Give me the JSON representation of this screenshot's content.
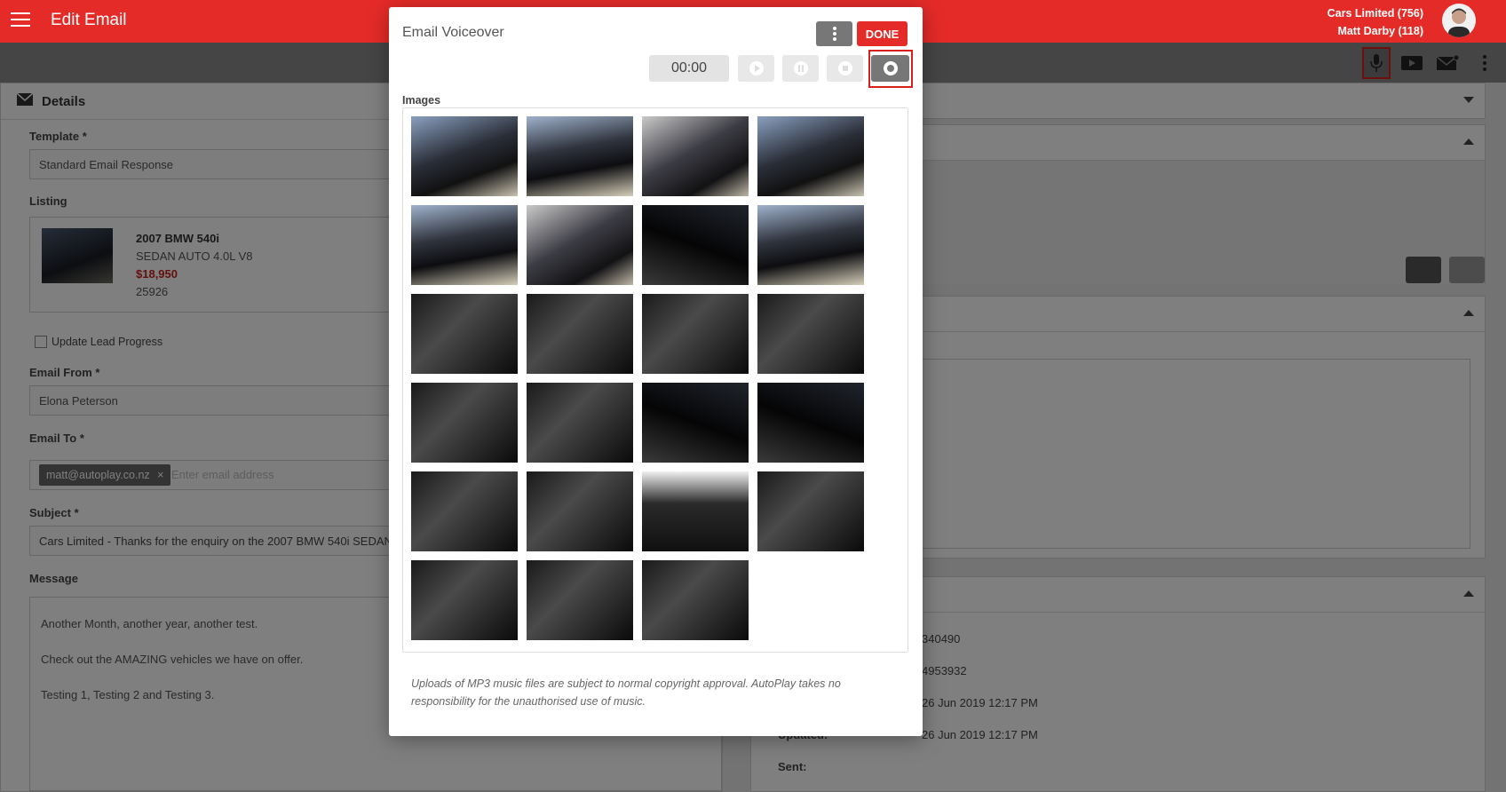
{
  "appbar": {
    "title": "Edit Email",
    "account_line1": "Cars Limited (756)",
    "account_line2": "Matt Darby (118)"
  },
  "toolbar": {
    "icons": [
      "microphone-icon",
      "video-icon",
      "email-settings-icon",
      "more-vertical-icon"
    ]
  },
  "details": {
    "heading": "Details",
    "template_label": "Template *",
    "template_value": "Standard Email Response",
    "listing_label": "Listing",
    "listing": {
      "title": "2007 BMW 540i",
      "subtitle": "SEDAN AUTO 4.0L V8",
      "price": "$18,950",
      "stock": "25926"
    },
    "update_lead_label": "Update Lead Progress",
    "email_from_label": "Email From *",
    "email_from_value": "Elona Peterson",
    "email_to_label": "Email To *",
    "email_to_chip": "matt@autoplay.co.nz",
    "email_to_placeholder": "Enter email address",
    "subject_label": "Subject *",
    "subject_value": "Cars Limited - Thanks for the enquiry on the 2007 BMW 540i SEDAN",
    "message_label": "Message",
    "message_lines": [
      "Another Month, another year, another test.",
      "Check out the AMAZING vehicles we have on offer.",
      "Testing 1, Testing 2 and Testing 3."
    ]
  },
  "right_panel": {
    "section2_partial": "s",
    "info_values": [
      "340490",
      "4953932",
      "26 Jun 2019 12:17 PM",
      "26 Jun 2019 12:17 PM"
    ],
    "info_partial_label": "Updated:",
    "sent_label": "Sent:"
  },
  "modal": {
    "title": "Email Voiceover",
    "done_label": "DONE",
    "timer": "00:00",
    "images_label": "Images",
    "image_count": 23,
    "disclaimer": "Uploads of MP3 music files are subject to normal copyright approval. AutoPlay takes no responsibility for the unauthorised use of music."
  },
  "colors": {
    "brand_red": "#e52b28",
    "record_highlight": "#d9201c",
    "price_red": "#c8201c"
  }
}
